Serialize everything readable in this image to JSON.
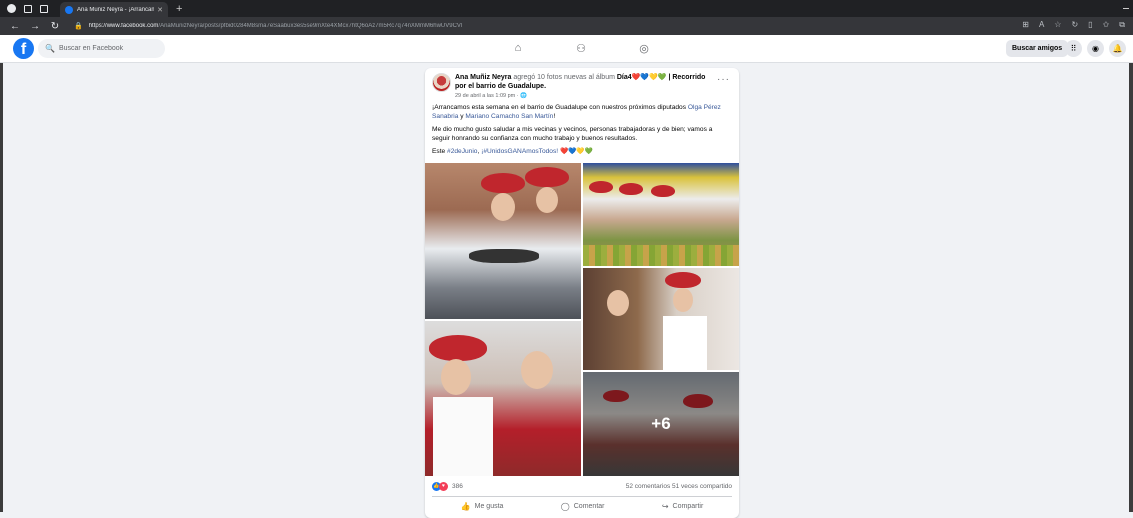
{
  "browser": {
    "tab_title": "Ana Muñiz Neyra - ¡Arrancamos",
    "url_domain": "https://www.facebook.com",
    "url_path": "/AnaMunizNeyra/posts/pfbid0284M8sma7eSaabux3es5se9mXte4XMcx7htQ6oAz7m5Rc7q74nXMmM6hwUV9CVl",
    "new_tab": "+",
    "icons": [
      "back-icon",
      "forward-icon",
      "refresh-icon"
    ]
  },
  "facebook": {
    "logo": "f",
    "search_placeholder": "Buscar en Facebook",
    "find_friends": "Buscar amigos"
  },
  "post": {
    "author": "Ana Muñiz Neyra",
    "action": " agregó 10 fotos nuevas al álbum ",
    "album": "Día4❤️💙💛💚 | Recorrido por el barrio de Guadalupe.",
    "timestamp": "29 de abril a las 1:09 pm · 🌐",
    "para1_start": "¡Arrancamos esta semana en el barrio de Guadalupe con nuestros próximos diputados ",
    "para1_link1": "Olga Pérez Sanabria",
    "para1_mid": " y ",
    "para1_link2": "Mariano Camacho San Martín",
    "para1_end": "!",
    "para2": "Me dio mucho gusto saludar a mis vecinas y vecinos, personas trabajadoras y de bien; vamos a seguir honrando su confianza con mucho trabajo y buenos resultados.",
    "para3_start": "Este ",
    "para3_tag1": "#2deJunio",
    "para3_mid": ", ",
    "para3_tag2": "¡#UnidosGANAmosTodos!",
    "para3_end": " ❤️💙💛💚",
    "more_photos": "+6",
    "reactions_count": "386",
    "comments_shares": "52 comentarios   51 veces compartido",
    "like_label": "Me gusta",
    "comment_label": "Comentar",
    "share_label": "Compartir"
  }
}
